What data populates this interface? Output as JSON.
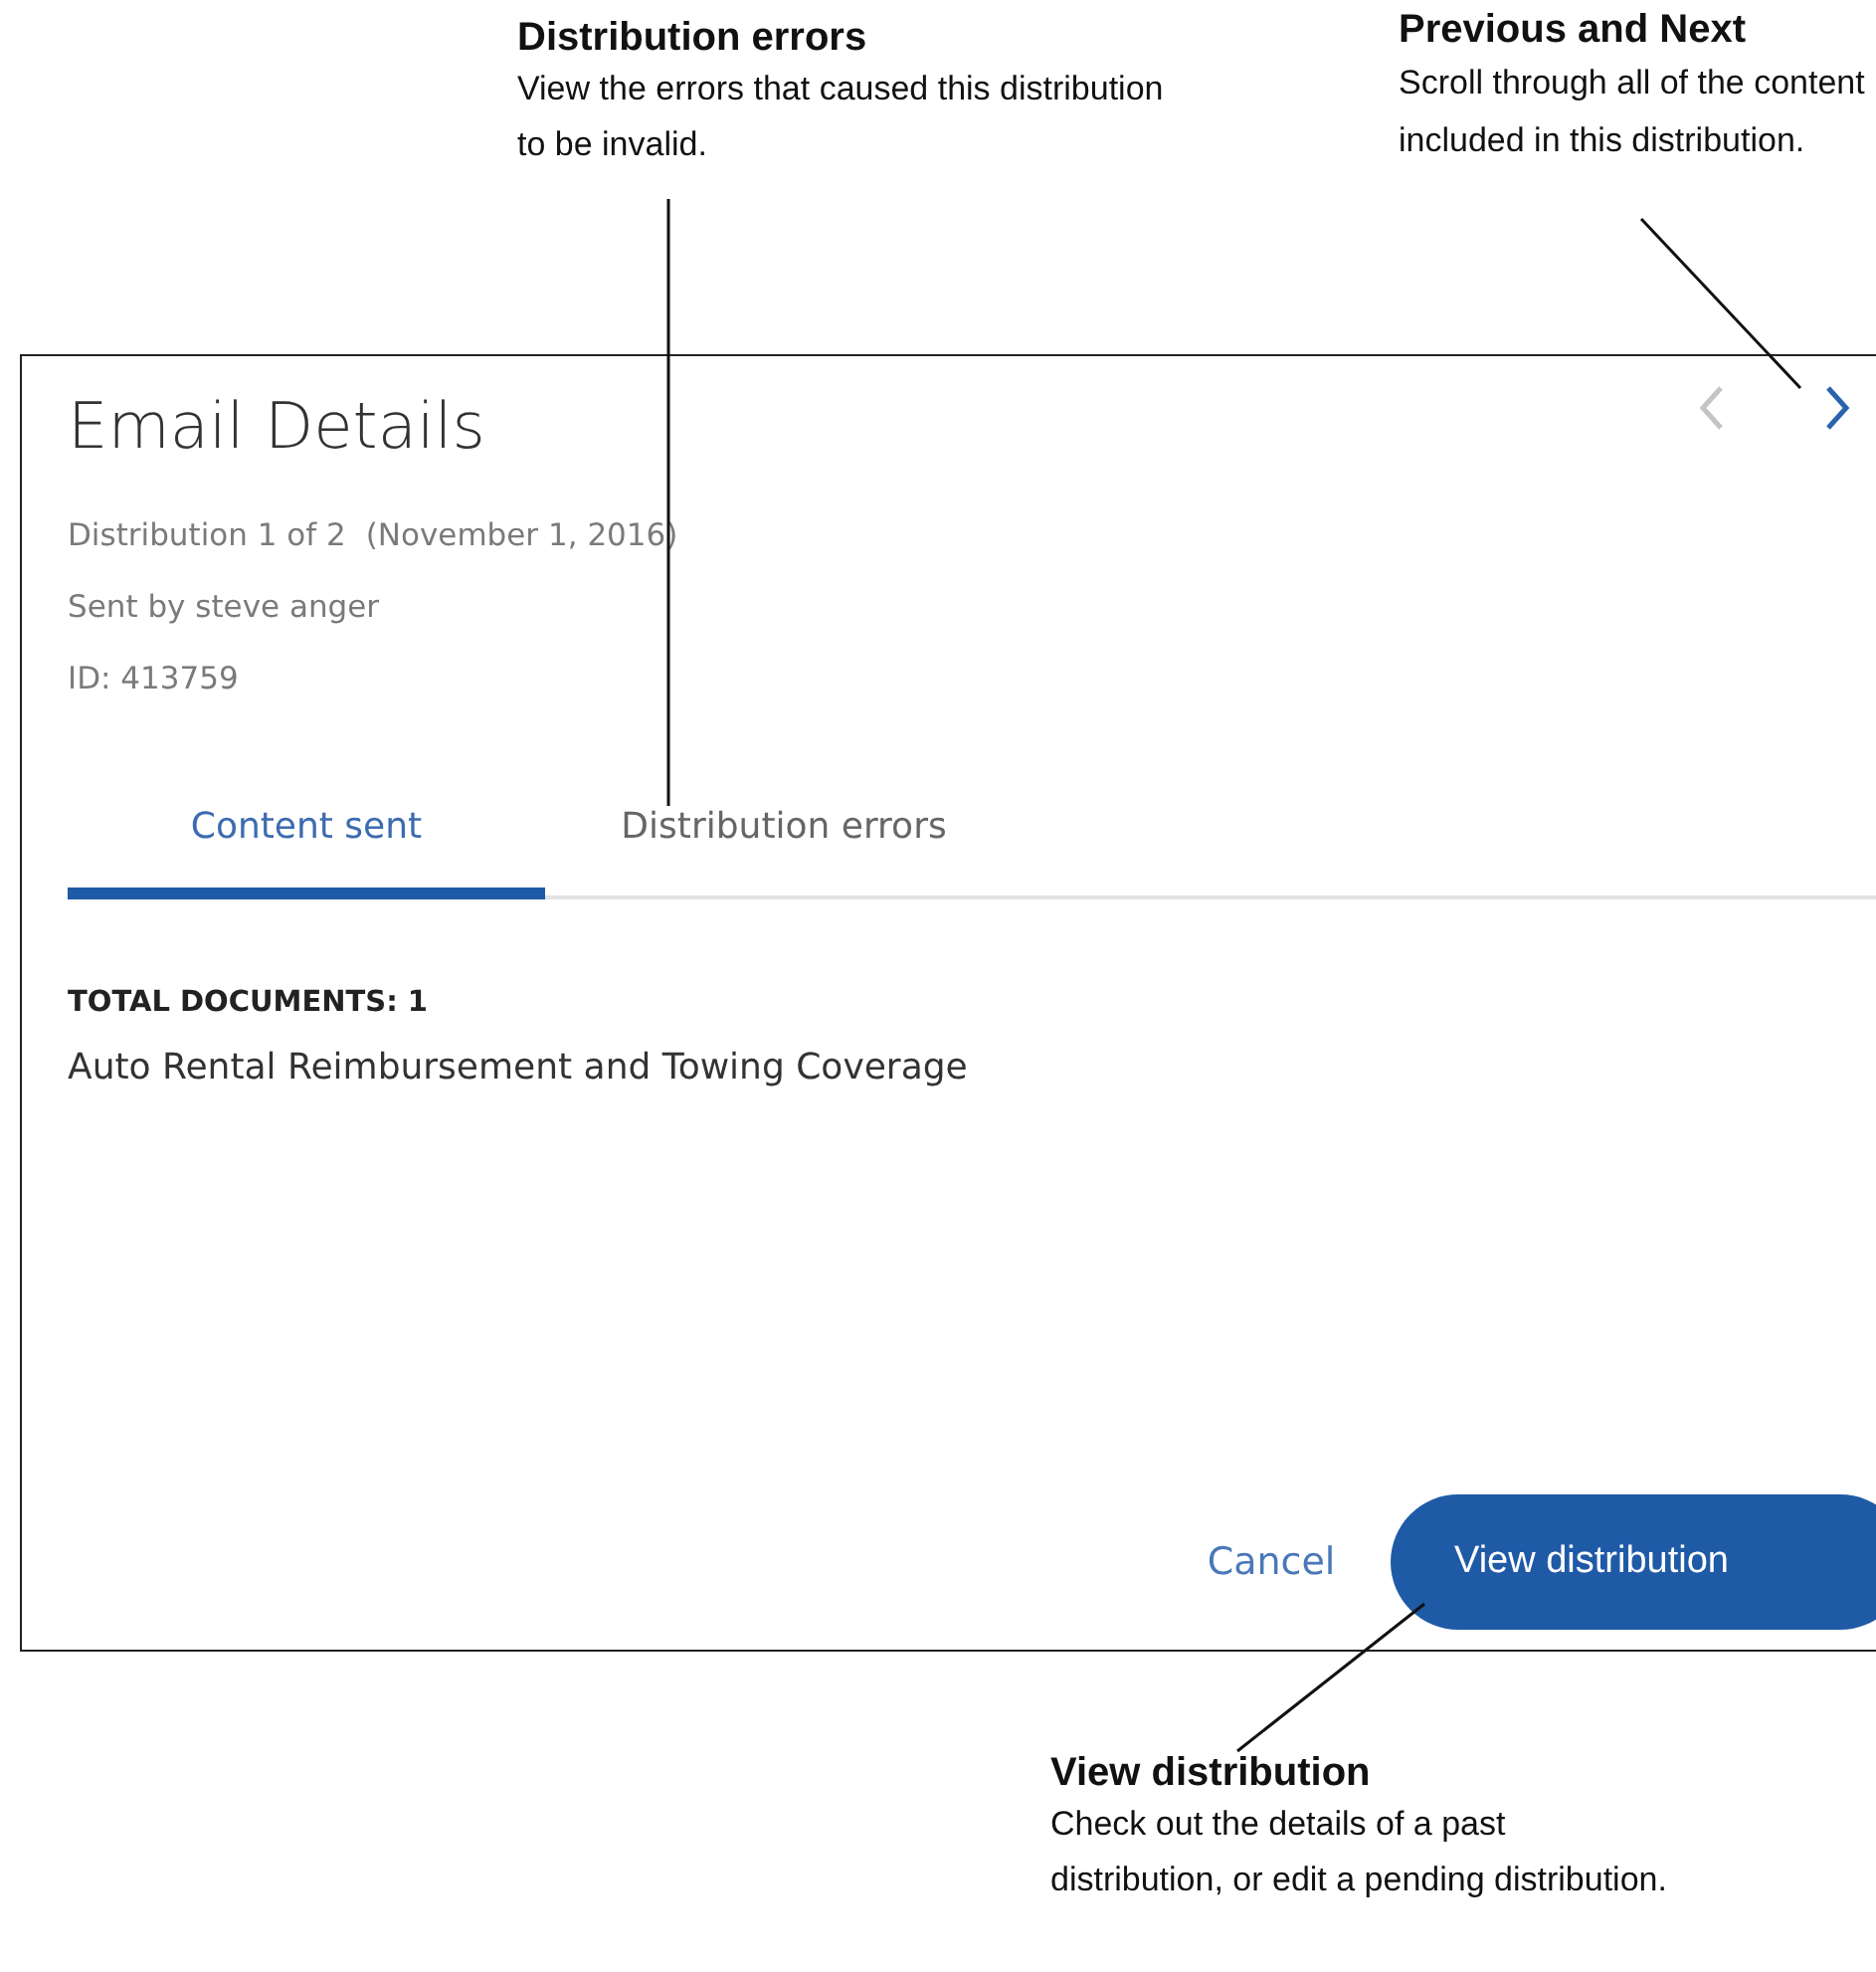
{
  "annotations": [
    {
      "title": "Distribution errors",
      "text": "View the errors that caused this distribution to be invalid."
    },
    {
      "title": "Previous and Next",
      "text": "Scroll through all of the content included in this distribution."
    },
    {
      "title": "View distribution",
      "text": "Check out the details of a past distribution, or edit a pending distribution."
    }
  ],
  "dialog": {
    "title": "Email Details",
    "distribution": "Distribution 1 of 2",
    "date": "(November 1, 2016)",
    "sent_by": "Sent by steve anger",
    "id": "ID: 413759",
    "nav": {
      "previous_disabled": true,
      "next_disabled": false
    },
    "tabs": [
      {
        "label": "Content sent",
        "selected": true
      },
      {
        "label": "Distribution errors",
        "selected": false
      }
    ],
    "documents_heading": "TOTAL DOCUMENTS: 1",
    "documents": [
      "Auto Rental Reimbursement and Towing Coverage"
    ],
    "buttons": {
      "cancel": "Cancel",
      "primary": "View distribution"
    }
  }
}
